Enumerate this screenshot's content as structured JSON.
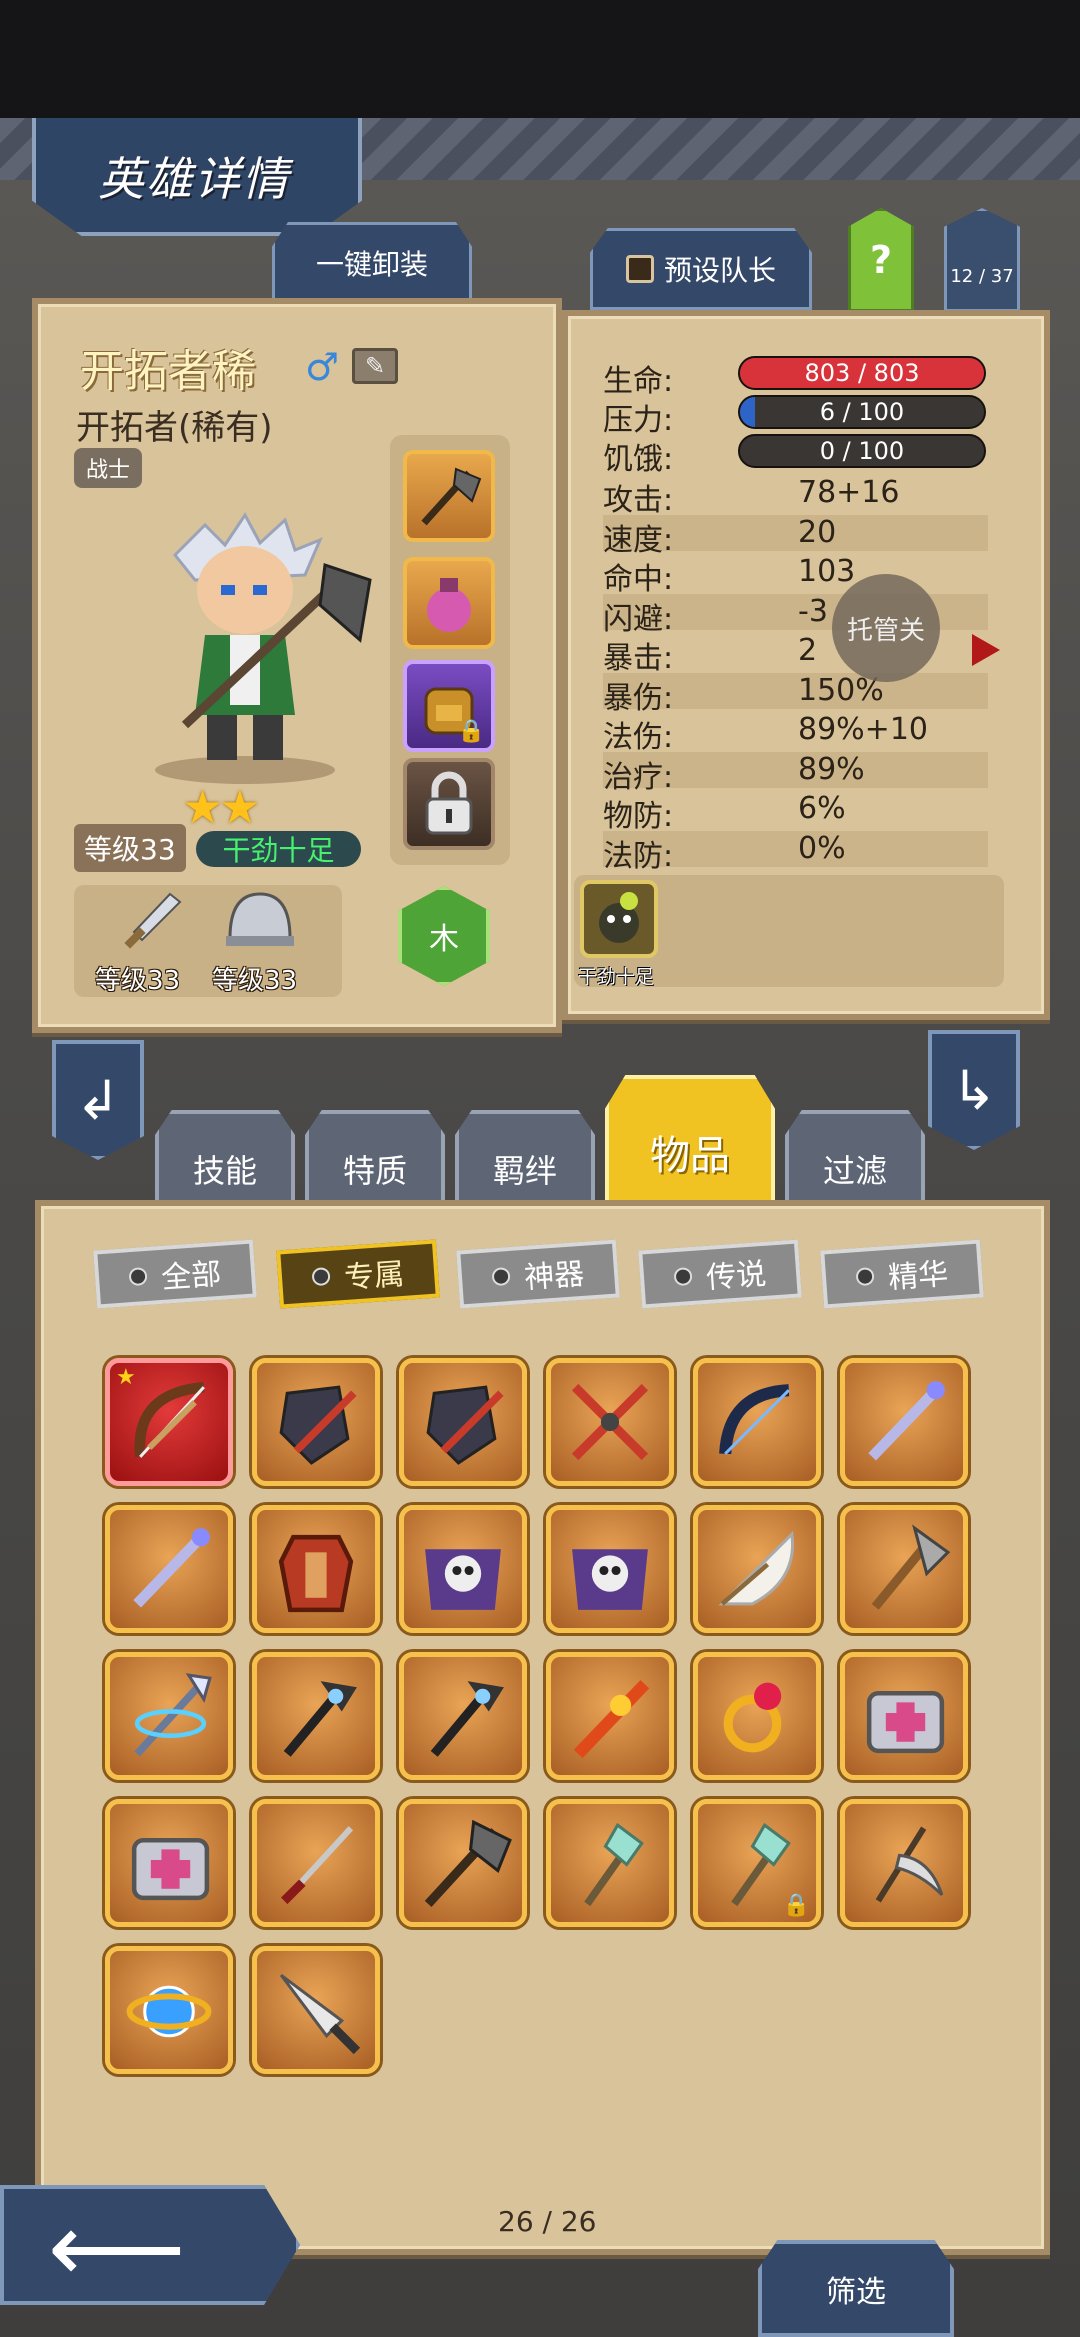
{
  "header": {
    "title": "英雄详情",
    "unequip_all_label": "一键卸装",
    "preset_captain_label": "预设队长",
    "help_label": "?",
    "hero_count": "12 / 37"
  },
  "hero": {
    "name": "开拓者稀",
    "class_name": "开拓者(稀有)",
    "role": "战士",
    "level": "等级33",
    "trait": "干劲十足",
    "stars": "★★",
    "weapon_level": "等级33",
    "armor_level": "等级33",
    "element": "木"
  },
  "stats": {
    "hp": {
      "label": "生命:",
      "value": "803 / 803",
      "fill": 1.0
    },
    "stress": {
      "label": "压力:",
      "value": "6 / 100",
      "fill": 0.06
    },
    "hunger": {
      "label": "饥饿:",
      "value": "0 / 100",
      "fill": 0.0
    },
    "rows": [
      {
        "label": "攻击:",
        "value": "78+16"
      },
      {
        "label": "速度:",
        "value": "20"
      },
      {
        "label": "命中:",
        "value": "103"
      },
      {
        "label": "闪避:",
        "value": "-3"
      },
      {
        "label": "暴击:",
        "value": "2"
      },
      {
        "label": "暴伤:",
        "value": "150%"
      },
      {
        "label": "法伤:",
        "value": "89%+10"
      },
      {
        "label": "治疗:",
        "value": "89%"
      },
      {
        "label": "物防:",
        "value": "6%"
      },
      {
        "label": "法防:",
        "value": "0%"
      }
    ],
    "auto_label": "托管关",
    "trait_caption": "干劲十足"
  },
  "tabs": [
    "技能",
    "特质",
    "羁绊",
    "物品",
    "过滤"
  ],
  "filters": [
    "全部",
    "专属",
    "神器",
    "传说",
    "精华"
  ],
  "items": [
    {
      "icon": "bow-icon",
      "frame": "red",
      "starred": true
    },
    {
      "icon": "shield-blade-icon"
    },
    {
      "icon": "shield-blade-icon"
    },
    {
      "icon": "crossed-daggers-icon"
    },
    {
      "icon": "dark-bow-icon"
    },
    {
      "icon": "ornate-staff-icon"
    },
    {
      "icon": "ornate-staff-icon"
    },
    {
      "icon": "armor-icon"
    },
    {
      "icon": "skull-cloak-icon"
    },
    {
      "icon": "skull-cloak-icon"
    },
    {
      "icon": "feather-fan-icon"
    },
    {
      "icon": "axe-icon"
    },
    {
      "icon": "spear-icon"
    },
    {
      "icon": "dark-scepter-icon"
    },
    {
      "icon": "dark-scepter-icon"
    },
    {
      "icon": "flame-sword-icon"
    },
    {
      "icon": "ruby-ring-icon"
    },
    {
      "icon": "medkit-icon"
    },
    {
      "icon": "medkit-icon"
    },
    {
      "icon": "katana-icon"
    },
    {
      "icon": "battle-axe-icon"
    },
    {
      "icon": "crystal-wand-icon"
    },
    {
      "icon": "crystal-wand-icon",
      "locked": true
    },
    {
      "icon": "scythe-icon"
    },
    {
      "icon": "orb-icon"
    },
    {
      "icon": "drill-lance-icon"
    }
  ],
  "pagination": "26 / 26",
  "footer": {
    "filter_label": "筛选"
  },
  "colors": {
    "hp_bar": "#d8333b",
    "stress_bar": "#2e63c8",
    "parchment": "#d9c39a",
    "active_tab": "#f0c222",
    "trait_text": "#48f070"
  }
}
